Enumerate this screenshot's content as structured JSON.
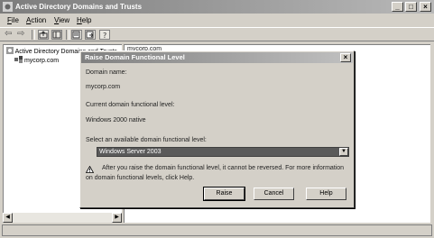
{
  "window": {
    "title": "Active Directory Domains and Trusts",
    "min_label": "_",
    "max_label": "□",
    "close_label": "×"
  },
  "menu": [
    {
      "mnemonic": "F",
      "rest": "ile"
    },
    {
      "mnemonic": "A",
      "rest": "ction"
    },
    {
      "mnemonic": "V",
      "rest": "iew"
    },
    {
      "mnemonic": "H",
      "rest": "elp"
    }
  ],
  "toolbar": {
    "back_label": "⇦",
    "forward_label": "⇨"
  },
  "tree": {
    "root_label": "Active Directory Domains and Trusts",
    "child_label": "mycorp.com"
  },
  "right_pane": {
    "header_label": "mycorp.com"
  },
  "dialog": {
    "title": "Raise Domain Functional Level",
    "close_label": "×",
    "domain_name_label": "Domain name:",
    "domain_name_value": "mycorp.com",
    "current_level_label": "Current domain functional level:",
    "current_level_value": "Windows 2000 native",
    "select_prompt": "Select an available domain functional level:",
    "select_value": "Windows Server 2003",
    "warning_line1": "After you raise the domain functional level, it cannot be reversed. For more information",
    "warning_line2": "on domain functional levels, click Help.",
    "buttons": {
      "raise": "Raise",
      "cancel": "Cancel",
      "help": "Help"
    }
  }
}
